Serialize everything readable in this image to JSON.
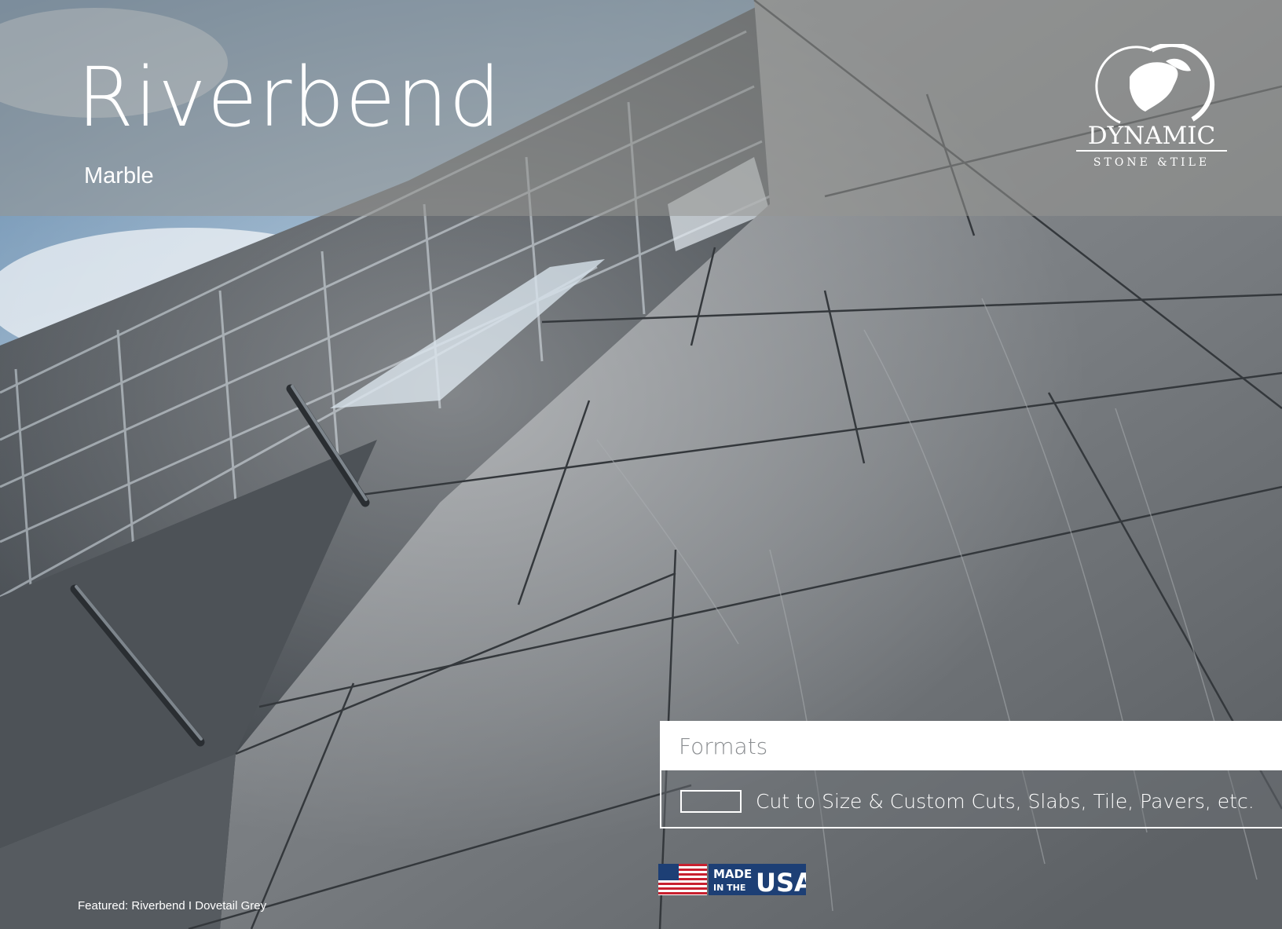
{
  "header": {
    "title": "Riverbend",
    "subtitle": "Marble"
  },
  "logo": {
    "icon": "globe-icon",
    "brand_name": "DYNAMIC",
    "brand_tagline": "STONE &TILE"
  },
  "formats": {
    "heading": "Formats",
    "item_text": "Cut to Size & Custom Cuts, Slabs, Tile, Pavers, etc."
  },
  "badge": {
    "icon": "us-flag-icon",
    "line1": "MADE",
    "line2": "IN THE",
    "country": "USA"
  },
  "caption": "Featured: Riverbend I Dovetail Grey"
}
